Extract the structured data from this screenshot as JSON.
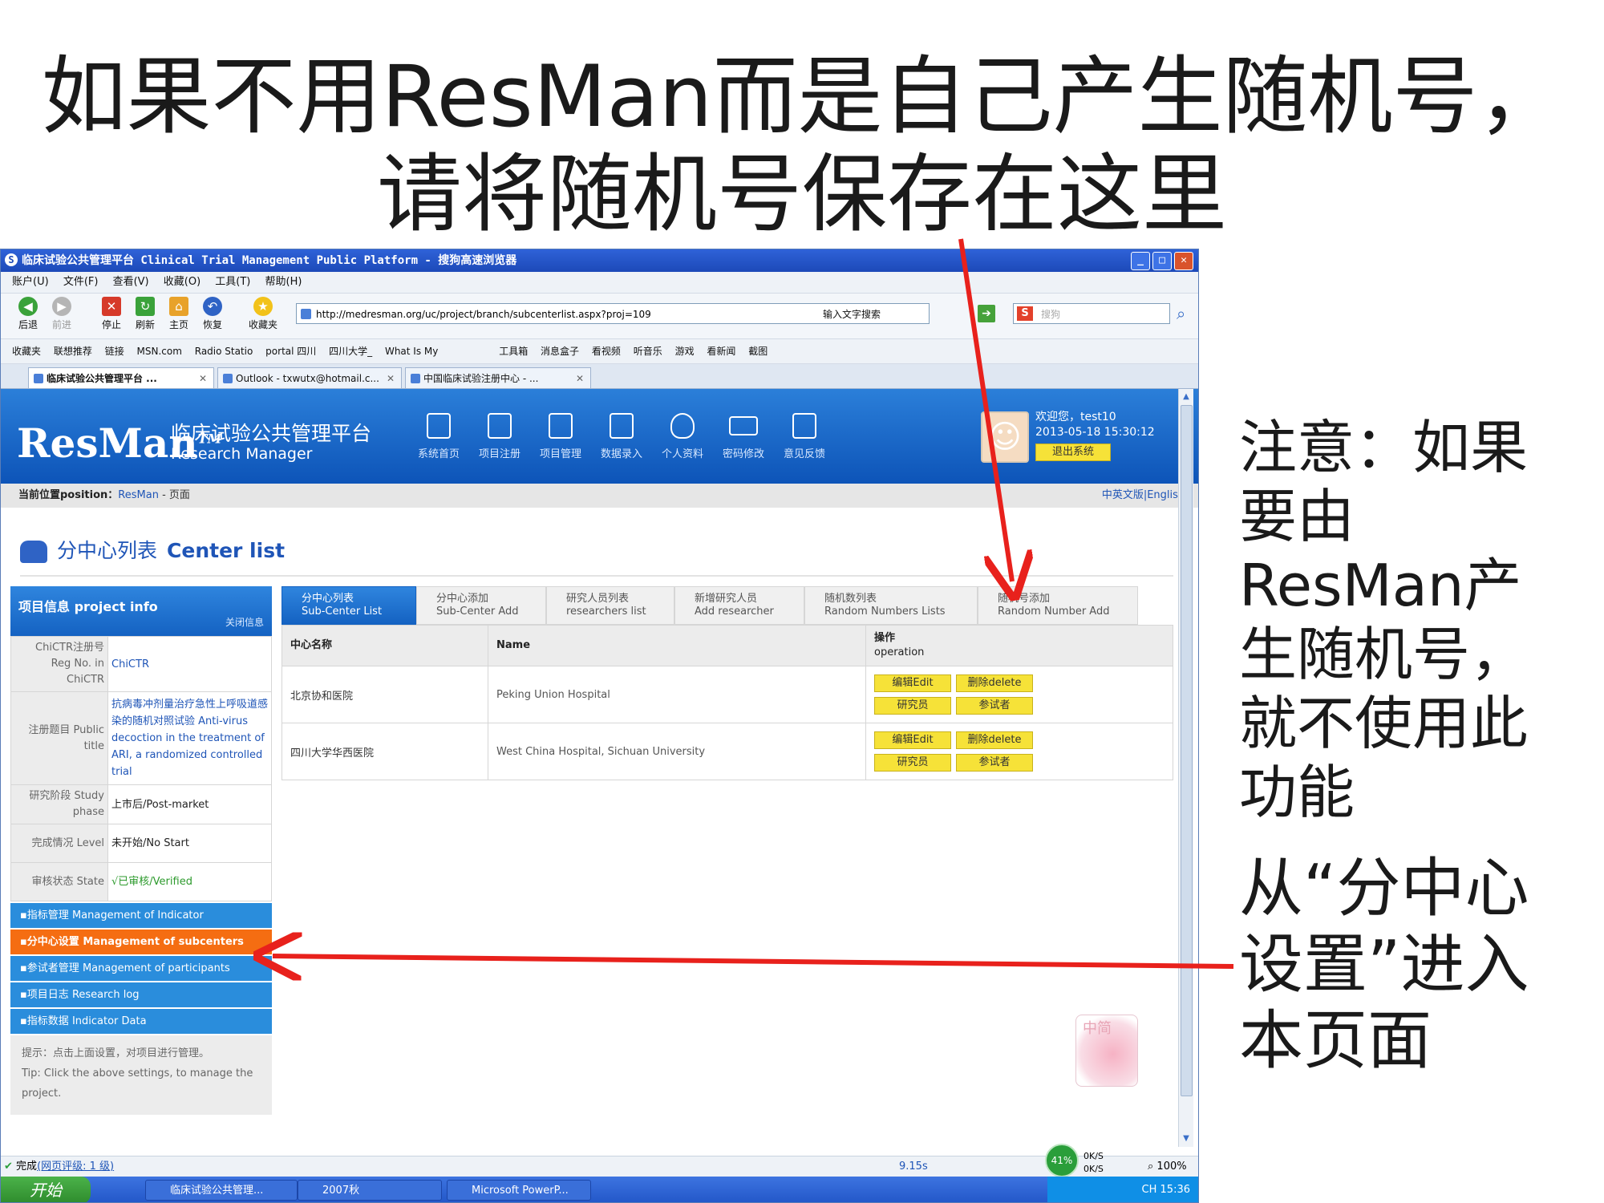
{
  "slide": {
    "title_line1": "如果不用ResMan而是自己产生随机号，",
    "title_line2": "请将随机号保存在这里",
    "note_right": "注意：如果要由ResMan产生随机号，就不使用此功能",
    "note_bottom": "从“分中心设置”进入本页面"
  },
  "browser": {
    "window_title": "临床试验公共管理平台 Clinical Trial Management Public Platform - 搜狗高速浏览器",
    "menu": [
      "账户(U)",
      "文件(F)",
      "查看(V)",
      "收藏(O)",
      "工具(T)",
      "帮助(H)"
    ],
    "toolbar": [
      {
        "label": "后退",
        "icon": "back-arrow-icon",
        "color": "#3aa23a"
      },
      {
        "label": "前进",
        "icon": "forward-arrow-icon",
        "color": "#b5b5b5"
      },
      {
        "label": "停止",
        "icon": "stop-icon",
        "color": "#d63a2a"
      },
      {
        "label": "刷新",
        "icon": "refresh-icon",
        "color": "#3aa23a"
      },
      {
        "label": "主页",
        "icon": "home-icon",
        "color": "#e8a22a"
      },
      {
        "label": "恢复",
        "icon": "restore-icon",
        "color": "#2f63c5"
      },
      {
        "label": "收藏夹",
        "icon": "star-icon",
        "color": "#f2c21a"
      }
    ],
    "address": "http://medresman.org/uc/project/branch/subcenterlist.aspx?proj=109",
    "address_hint": "输入文字搜索",
    "search_placeholder": "搜狗",
    "favorites": [
      "收藏夹",
      "联想推荐",
      "链接",
      "MSN.com",
      "Radio Statio",
      "portal 四川",
      "四川大学_",
      "What Is My",
      "工具箱",
      "消息盒子",
      "看视频",
      "听音乐",
      "游戏",
      "看新闻",
      "截图"
    ],
    "tabs": [
      "临床试验公共管理平台 ...",
      "Outlook - txwutx@hotmail.c...",
      "中国临床试验注册中心 - ..."
    ]
  },
  "page": {
    "brand": "ResMan",
    "brand_tm": "TM",
    "brand_cn": "临床试验公共管理平台",
    "brand_en": "Research Manager",
    "nav": [
      "系统首页",
      "项目注册",
      "项目管理",
      "数据录入",
      "个人资料",
      "密码修改",
      "意见反馈"
    ],
    "welcome": "欢迎您，test10",
    "datetime": "2013-05-18 15:30:12",
    "logout": "退出系统",
    "position_label": "当前位置position：",
    "position_link": "ResMan",
    "position_rest": " - 页面",
    "lang": "中英文版|Englist",
    "heading_cn": "分中心列表",
    "heading_en": "Center list",
    "project_info_title": "项目信息  project info",
    "project_info_close": "关闭信息",
    "project_info": [
      {
        "k": "ChiCTR注册号 Reg No. in ChiCTR",
        "v": "ChiCTR",
        "style": "link"
      },
      {
        "k": "注册题目 Public title",
        "v": "抗病毒冲剂量治疗急性上呼吸道感染的随机对照试验 Anti-virus decoction in the treatment of ARI, a randomized controlled trial",
        "style": "link"
      },
      {
        "k": "研究阶段 Study phase",
        "v": "上市后/Post-market",
        "style": "dark"
      },
      {
        "k": "完成情况 Level",
        "v": "未开始/No Start",
        "style": "dark"
      },
      {
        "k": "审核状态 State",
        "v": "√已审核/Verified",
        "style": "green"
      }
    ],
    "side_menu": [
      {
        "label": "▪指标管理  Management of Indicator",
        "active": false
      },
      {
        "label": "▪分中心设置  Management of subcenters",
        "active": true
      },
      {
        "label": "▪参试者管理  Management of participants",
        "active": false
      },
      {
        "label": "▪项目日志  Research log",
        "active": false
      },
      {
        "label": "▪指标数据  Indicator Data",
        "active": false
      }
    ],
    "tip_cn": "提示：点击上面设置，对项目进行管理。",
    "tip_en": "Tip: Click the above settings, to manage the project.",
    "content_tabs": [
      {
        "cn": "分中心列表",
        "en": "Sub-Center List",
        "active": true
      },
      {
        "cn": "分中心添加",
        "en": "Sub-Center Add",
        "active": false
      },
      {
        "cn": "研究人员列表",
        "en": "researchers list",
        "active": false
      },
      {
        "cn": "新增研究人员",
        "en": "Add researcher",
        "active": false
      },
      {
        "cn": "随机数列表",
        "en": "Random Numbers Lists",
        "active": false
      },
      {
        "cn": "随机号添加",
        "en": "Random Number Add",
        "active": false
      }
    ],
    "table_headers": {
      "c1": "中心名称",
      "c2": "Name",
      "c3_cn": "操作",
      "c3_en": "operation"
    },
    "rows": [
      {
        "cn": "北京协和医院",
        "en": "Peking Union Hospital"
      },
      {
        "cn": "四川大学华西医院",
        "en": "West China Hospital, Sichuan University"
      }
    ],
    "row_buttons": [
      "编辑Edit",
      "删除delete",
      "研究员",
      "参试者"
    ],
    "rose_text": "中简"
  },
  "status": {
    "done": "完成",
    "rating": "(网页评级: 1 级)",
    "speed": "9.15s",
    "percent": "41%",
    "up": "0K/S",
    "down": "0K/S",
    "zoom": "100%"
  },
  "taskbar": {
    "start": "开始",
    "tasks": [
      "临床试验公共管理...",
      "2007秋",
      "Microsoft PowerP..."
    ],
    "clock": "CH  15:36"
  },
  "colors": {
    "annotation_arrow": "#e8211c",
    "accent": "#1462c2",
    "active_menu": "#f56d12"
  }
}
